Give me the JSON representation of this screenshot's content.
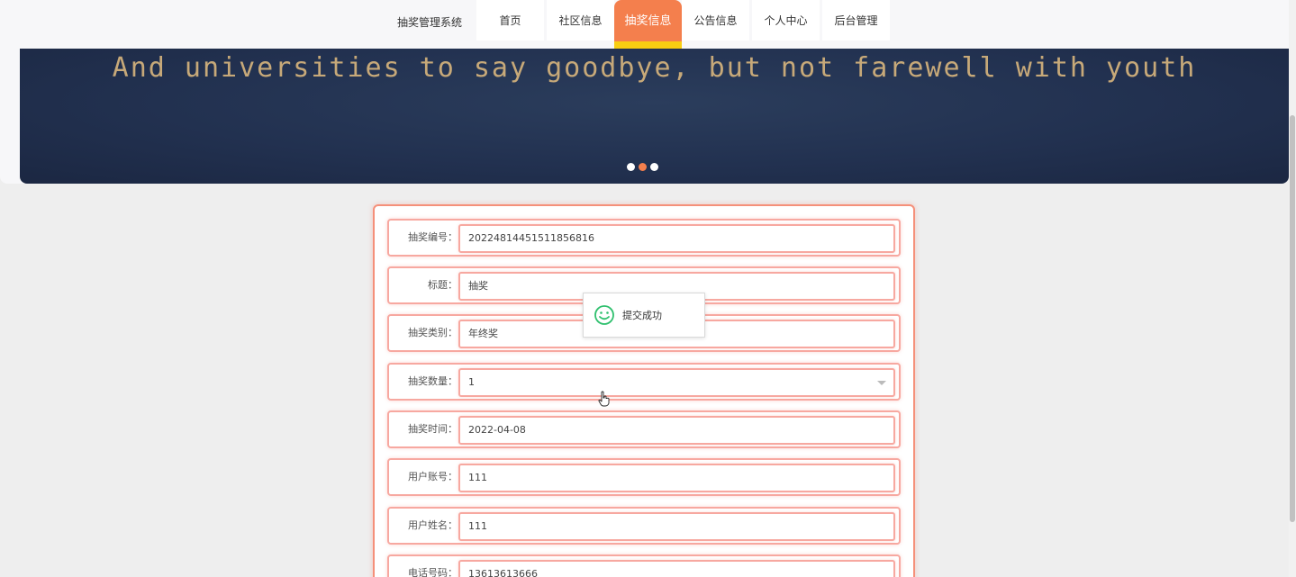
{
  "nav": {
    "brand": "抽奖管理系统",
    "items": [
      {
        "label": "首页",
        "active": false
      },
      {
        "label": "社区信息",
        "active": false
      },
      {
        "label": "抽奖信息",
        "active": true
      },
      {
        "label": "公告信息",
        "active": false
      },
      {
        "label": "个人中心",
        "active": false
      },
      {
        "label": "后台管理",
        "active": false
      }
    ]
  },
  "banner": {
    "text": "And universities to say goodbye, but not farewell with youth",
    "slide_count": 3,
    "active_slide": 2
  },
  "form": {
    "fields": [
      {
        "label": "抽奖编号：",
        "value": "20224814451511856816"
      },
      {
        "label": "标题：",
        "value": "抽奖"
      },
      {
        "label": "抽奖类别：",
        "value": "年终奖"
      },
      {
        "label": "抽奖数量：",
        "value": "1"
      },
      {
        "label": "抽奖时间：",
        "value": "2022-04-08"
      },
      {
        "label": "用户账号：",
        "value": "111"
      },
      {
        "label": "用户姓名：",
        "value": "111"
      },
      {
        "label": "电话号码：",
        "value": "13613613666"
      }
    ]
  },
  "toast": {
    "message": "提交成功",
    "icon": "smile-icon"
  },
  "colors": {
    "accent": "#f47f4d",
    "accent_underline": "#f8ce12",
    "banner_bg": "#223150",
    "banner_text": "#c7a979",
    "field_border": "#f7a8a0",
    "success_icon": "#2fc06e"
  }
}
